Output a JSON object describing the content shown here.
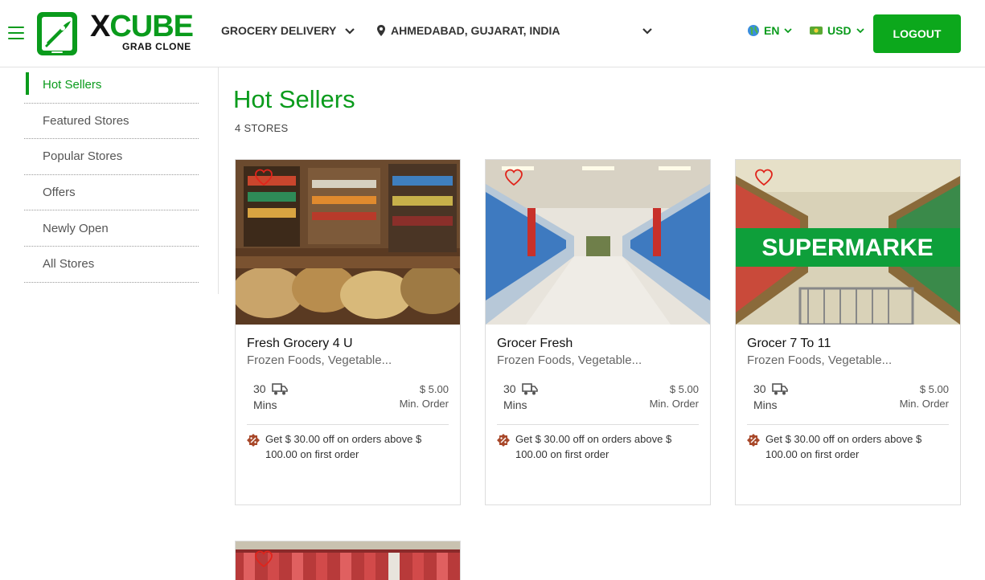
{
  "header": {
    "logo": {
      "brand_x": "X",
      "brand_rest": "CUBE",
      "tagline": "GRAB CLONE"
    },
    "service": "GROCERY DELIVERY",
    "location": "AHMEDABAD, GUJARAT, INDIA",
    "language": "EN",
    "currency": "USD",
    "logout_label": "LOGOUT"
  },
  "sidebar": {
    "items": [
      {
        "label": "Hot Sellers",
        "active": true
      },
      {
        "label": "Featured Stores"
      },
      {
        "label": "Popular Stores"
      },
      {
        "label": "Offers"
      },
      {
        "label": "Newly Open"
      },
      {
        "label": "All Stores"
      }
    ]
  },
  "main": {
    "title": "Hot Sellers",
    "count": "4 STORES",
    "stores": [
      {
        "name": "Fresh Grocery 4 U",
        "categories": "Frozen Foods, Vegetable...",
        "time_value": "30",
        "time_unit": "Mins",
        "min_order": "$ 5.00",
        "min_order_label": "Min. Order",
        "offer": "Get $ 30.00 off on orders above $ 100.00 on first order"
      },
      {
        "name": "Grocer Fresh",
        "categories": "Frozen Foods, Vegetable...",
        "time_value": "30",
        "time_unit": "Mins",
        "min_order": "$ 5.00",
        "min_order_label": "Min. Order",
        "offer": "Get $ 30.00 off on orders above $ 100.00 on first order"
      },
      {
        "name": "Grocer 7 To 11",
        "categories": "Frozen Foods, Vegetable...",
        "time_value": "30",
        "time_unit": "Mins",
        "min_order": "$ 5.00",
        "min_order_label": "Min. Order",
        "offer": "Get $ 30.00 off on orders above $ 100.00 on first order"
      }
    ],
    "image_texts": {
      "store3_banner": "SUPERMARKE"
    }
  },
  "colors": {
    "accent": "#0a9b1c",
    "button": "#0ca81c",
    "heart": "#e0241b"
  },
  "icons": [
    "menu-icon",
    "logo-rocket-icon",
    "chevron-down-icon",
    "map-pin-icon",
    "globe-icon",
    "currency-note-icon",
    "heart-icon",
    "delivery-truck-icon",
    "discount-icon"
  ]
}
